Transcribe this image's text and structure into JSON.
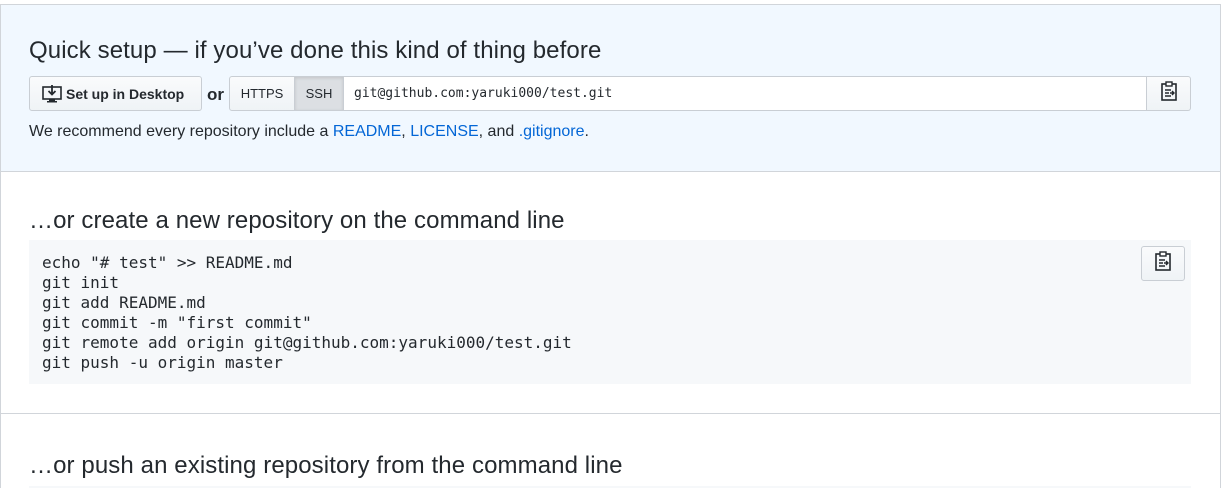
{
  "quick_setup": {
    "title": "Quick setup — if you’ve done this kind of thing before",
    "desktop_button": "Set up in Desktop",
    "or_label": "or",
    "protocols": [
      "HTTPS",
      "SSH"
    ],
    "selected_protocol": "SSH",
    "clone_url": "git@github.com:yaruki000/test.git",
    "recommend": {
      "prefix": "We recommend every repository include a ",
      "readme": "README",
      "comma1": ", ",
      "license": "LICENSE",
      "and": ", and ",
      "gitignore": ".gitignore",
      "suffix": "."
    }
  },
  "new_repo": {
    "title": "…or create a new repository on the command line",
    "code": "echo \"# test\" >> README.md\ngit init\ngit add README.md\ngit commit -m \"first commit\"\ngit remote add origin git@github.com:yaruki000/test.git\ngit push -u origin master"
  },
  "push_repo": {
    "title": "…or push an existing repository from the command line"
  },
  "icons": {
    "desktop": "desktop-download-icon",
    "clipboard": "clippy-icon"
  }
}
